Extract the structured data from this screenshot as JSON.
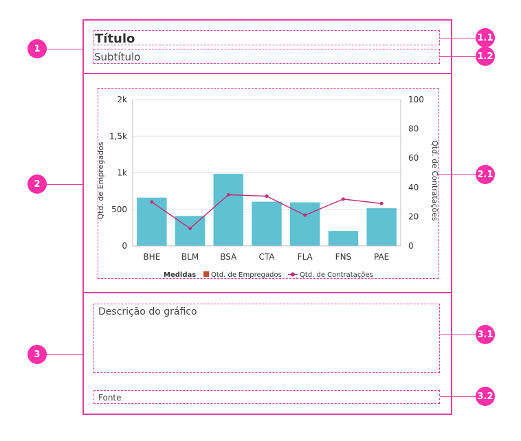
{
  "badges": {
    "b1": "1",
    "b11": "1.1",
    "b12": "1.2",
    "b2": "2",
    "b21": "2.1",
    "b3": "3",
    "b31": "3.1",
    "b32": "3.2"
  },
  "header": {
    "title": "Título",
    "subtitle": "Subtítulo"
  },
  "footer": {
    "description": "Descrição do gráfico",
    "source": "Fonte"
  },
  "colors": {
    "frame": "#e040a0",
    "badge": "#ff2fa8",
    "bars": "#5fc1d2",
    "line": "#c2307a",
    "legend_bar": "#c0502a"
  },
  "chart_data": {
    "type": "bar",
    "categories": [
      "BHE",
      "BLM",
      "BSA",
      "CTA",
      "FLA",
      "FNS",
      "PAE"
    ],
    "series": [
      {
        "name": "Qtd. de Empregados",
        "type": "bar",
        "axis": "left",
        "values": [
          660,
          410,
          985,
          605,
          595,
          205,
          515
        ]
      },
      {
        "name": "Qtd. de Contratações",
        "type": "line",
        "axis": "right",
        "values": [
          30,
          12,
          35,
          34,
          21,
          32,
          29
        ]
      }
    ],
    "ylabel": "Qtd. de Empregados",
    "y2label": "Qtd. de Contratações",
    "ylim": [
      0,
      2000
    ],
    "y2lim": [
      0,
      100
    ],
    "yticks": [
      "0",
      "500",
      "1k",
      "1,5k",
      "2k"
    ],
    "y2ticks": [
      "0",
      "20",
      "40",
      "60",
      "80",
      "100"
    ],
    "legend_title": "Medidas",
    "legend_position": "bottom",
    "grid": true
  }
}
